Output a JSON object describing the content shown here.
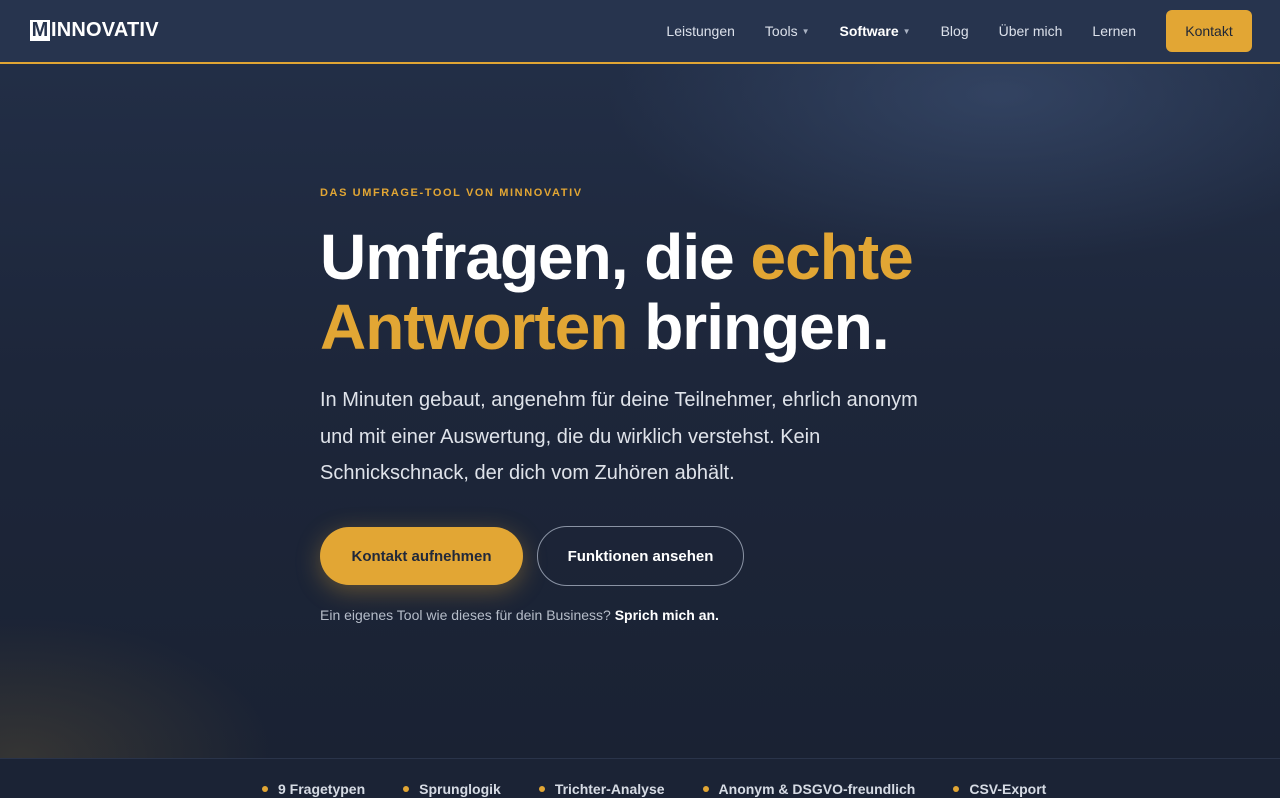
{
  "brand": {
    "logo_letter": "M",
    "logo_rest": "INNOVATIV"
  },
  "nav": {
    "items": [
      {
        "label": "Leistungen",
        "dropdown": false
      },
      {
        "label": "Tools",
        "dropdown": true
      },
      {
        "label": "Software",
        "dropdown": true
      },
      {
        "label": "Blog",
        "dropdown": false
      },
      {
        "label": "Über mich",
        "dropdown": false
      },
      {
        "label": "Lernen",
        "dropdown": false
      }
    ],
    "active": "Software",
    "cta": "Kontakt"
  },
  "hero": {
    "eyebrow": "DAS UMFRAGE-TOOL VON MINNOVATIV",
    "headline": {
      "part1": "Umfragen, die ",
      "accent": "echte Antworten",
      "part2": " bringen."
    },
    "lead": "In Minuten gebaut, angenehm für deine Teilnehmer, ehrlich anonym und mit einer Auswertung, die du wirklich verstehst. Kein Schnickschnack, der dich vom Zuhören abhält.",
    "primary_cta": "Kontakt aufnehmen",
    "secondary_cta": "Funktionen ansehen",
    "note_text": "Ein eigenes Tool wie dieses für dein Business? ",
    "note_link": "Sprich mich an."
  },
  "features": [
    "9 Fragetypen",
    "Sprunglogik",
    "Trichter-Analyse",
    "Anonym & DSGVO-freundlich",
    "CSV-Export"
  ],
  "colors": {
    "accent": "#e2a634",
    "navbar": "#27344e",
    "background": "#1b2335"
  }
}
